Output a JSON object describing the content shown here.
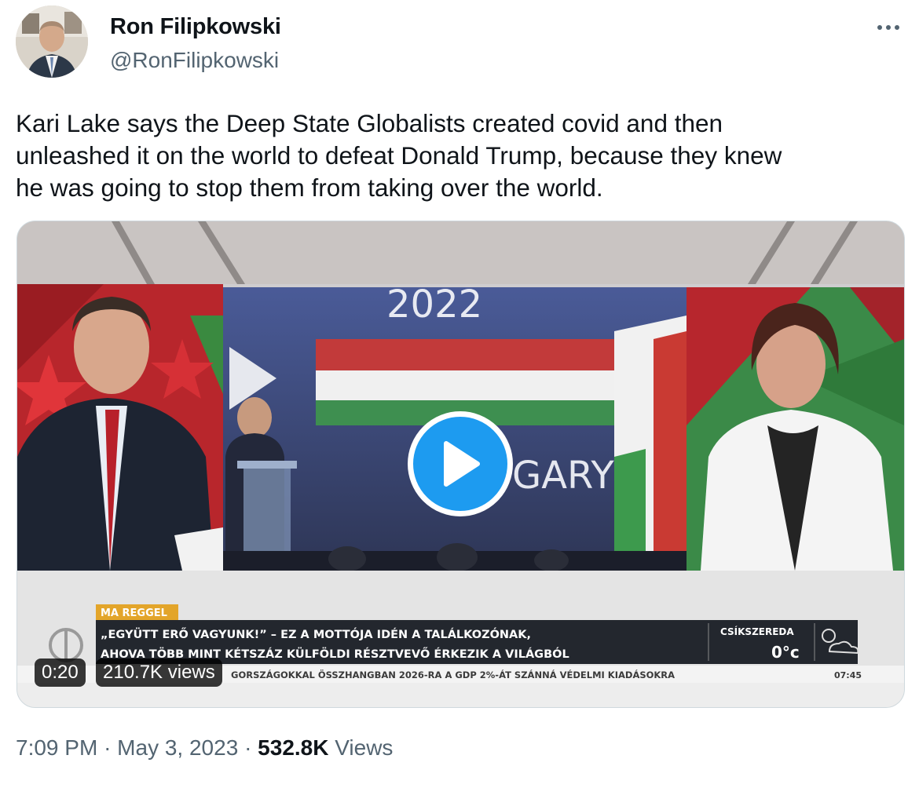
{
  "author": {
    "display_name": "Ron Filipkowski",
    "handle": "@RonFilipkowski",
    "avatar_icon": "profile-photo-icon"
  },
  "more_icon": "more-dots-icon",
  "tweet": {
    "text_lines": [
      "Kari Lake says the Deep State Globalists created covid and then",
      "unleashed it on the world to defeat Donald Trump, because they knew",
      "he was going to stop them from taking over the world."
    ]
  },
  "video": {
    "duration": "0:20",
    "views": "210.7K views",
    "play_icon": "play-icon",
    "accent_color": "#1d9bf0",
    "frame": {
      "stage_year": "2022",
      "stage_word": "GARY",
      "lower_third": {
        "tag": "MA REGGEL",
        "headline_1": "„EGYÜTT ERŐ VAGYUNK!” – EZ A MOTTÓJA IDÉN A TALÁLKOZÓNAK,",
        "headline_2": "AHOVA TÖBB MINT KÉTSZÁZ KÜLFÖLDI RÉSZTVEVŐ ÉRKEZIK A VILÁGBÓL",
        "crawl": "GORSZÁGOKKAL ÖSSZHANGBAN 2026-RA A GDP 2%-ÁT SZÁNNÁ VÉDELMI KIADÁSOKRA",
        "city": "CSÍKSZEREDA",
        "temperature": "0°c",
        "clock": "07:45"
      }
    }
  },
  "meta": {
    "time": "7:09 PM",
    "date": "May 3, 2023",
    "separator": "·",
    "view_count": "532.8K",
    "views_label": "Views"
  }
}
